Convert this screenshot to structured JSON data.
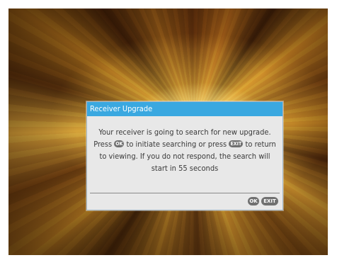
{
  "dialog": {
    "title": "Receiver Upgrade",
    "message": {
      "part1": "Your receiver is going to search for new upgrade. Press ",
      "ok_key": "OK",
      "part2": " to initiate searching or press ",
      "exit_key": "EXIT",
      "part3": " to return to viewing. If you do not respond, the search will start in 55 seconds"
    },
    "buttons": {
      "ok_label": "OK",
      "exit_label": "EXIT"
    }
  },
  "colors": {
    "title_bar": "#3aa8e0",
    "dialog_bg": "#e8e8e8",
    "key_badge": "#707070"
  }
}
